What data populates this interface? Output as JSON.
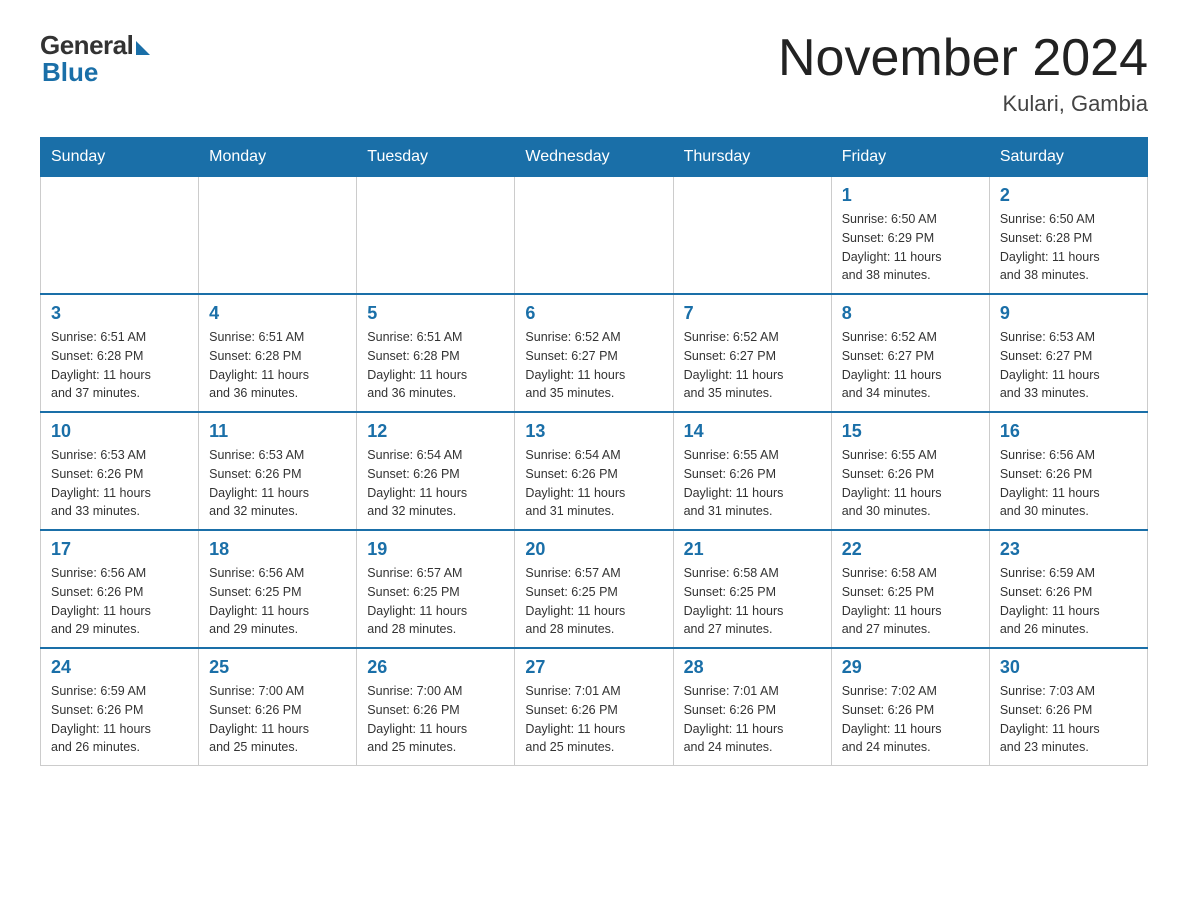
{
  "logo": {
    "general": "General",
    "blue": "Blue"
  },
  "title": "November 2024",
  "subtitle": "Kulari, Gambia",
  "days_of_week": [
    "Sunday",
    "Monday",
    "Tuesday",
    "Wednesday",
    "Thursday",
    "Friday",
    "Saturday"
  ],
  "weeks": [
    [
      {
        "day": "",
        "info": ""
      },
      {
        "day": "",
        "info": ""
      },
      {
        "day": "",
        "info": ""
      },
      {
        "day": "",
        "info": ""
      },
      {
        "day": "",
        "info": ""
      },
      {
        "day": "1",
        "info": "Sunrise: 6:50 AM\nSunset: 6:29 PM\nDaylight: 11 hours\nand 38 minutes."
      },
      {
        "day": "2",
        "info": "Sunrise: 6:50 AM\nSunset: 6:28 PM\nDaylight: 11 hours\nand 38 minutes."
      }
    ],
    [
      {
        "day": "3",
        "info": "Sunrise: 6:51 AM\nSunset: 6:28 PM\nDaylight: 11 hours\nand 37 minutes."
      },
      {
        "day": "4",
        "info": "Sunrise: 6:51 AM\nSunset: 6:28 PM\nDaylight: 11 hours\nand 36 minutes."
      },
      {
        "day": "5",
        "info": "Sunrise: 6:51 AM\nSunset: 6:28 PM\nDaylight: 11 hours\nand 36 minutes."
      },
      {
        "day": "6",
        "info": "Sunrise: 6:52 AM\nSunset: 6:27 PM\nDaylight: 11 hours\nand 35 minutes."
      },
      {
        "day": "7",
        "info": "Sunrise: 6:52 AM\nSunset: 6:27 PM\nDaylight: 11 hours\nand 35 minutes."
      },
      {
        "day": "8",
        "info": "Sunrise: 6:52 AM\nSunset: 6:27 PM\nDaylight: 11 hours\nand 34 minutes."
      },
      {
        "day": "9",
        "info": "Sunrise: 6:53 AM\nSunset: 6:27 PM\nDaylight: 11 hours\nand 33 minutes."
      }
    ],
    [
      {
        "day": "10",
        "info": "Sunrise: 6:53 AM\nSunset: 6:26 PM\nDaylight: 11 hours\nand 33 minutes."
      },
      {
        "day": "11",
        "info": "Sunrise: 6:53 AM\nSunset: 6:26 PM\nDaylight: 11 hours\nand 32 minutes."
      },
      {
        "day": "12",
        "info": "Sunrise: 6:54 AM\nSunset: 6:26 PM\nDaylight: 11 hours\nand 32 minutes."
      },
      {
        "day": "13",
        "info": "Sunrise: 6:54 AM\nSunset: 6:26 PM\nDaylight: 11 hours\nand 31 minutes."
      },
      {
        "day": "14",
        "info": "Sunrise: 6:55 AM\nSunset: 6:26 PM\nDaylight: 11 hours\nand 31 minutes."
      },
      {
        "day": "15",
        "info": "Sunrise: 6:55 AM\nSunset: 6:26 PM\nDaylight: 11 hours\nand 30 minutes."
      },
      {
        "day": "16",
        "info": "Sunrise: 6:56 AM\nSunset: 6:26 PM\nDaylight: 11 hours\nand 30 minutes."
      }
    ],
    [
      {
        "day": "17",
        "info": "Sunrise: 6:56 AM\nSunset: 6:26 PM\nDaylight: 11 hours\nand 29 minutes."
      },
      {
        "day": "18",
        "info": "Sunrise: 6:56 AM\nSunset: 6:25 PM\nDaylight: 11 hours\nand 29 minutes."
      },
      {
        "day": "19",
        "info": "Sunrise: 6:57 AM\nSunset: 6:25 PM\nDaylight: 11 hours\nand 28 minutes."
      },
      {
        "day": "20",
        "info": "Sunrise: 6:57 AM\nSunset: 6:25 PM\nDaylight: 11 hours\nand 28 minutes."
      },
      {
        "day": "21",
        "info": "Sunrise: 6:58 AM\nSunset: 6:25 PM\nDaylight: 11 hours\nand 27 minutes."
      },
      {
        "day": "22",
        "info": "Sunrise: 6:58 AM\nSunset: 6:25 PM\nDaylight: 11 hours\nand 27 minutes."
      },
      {
        "day": "23",
        "info": "Sunrise: 6:59 AM\nSunset: 6:26 PM\nDaylight: 11 hours\nand 26 minutes."
      }
    ],
    [
      {
        "day": "24",
        "info": "Sunrise: 6:59 AM\nSunset: 6:26 PM\nDaylight: 11 hours\nand 26 minutes."
      },
      {
        "day": "25",
        "info": "Sunrise: 7:00 AM\nSunset: 6:26 PM\nDaylight: 11 hours\nand 25 minutes."
      },
      {
        "day": "26",
        "info": "Sunrise: 7:00 AM\nSunset: 6:26 PM\nDaylight: 11 hours\nand 25 minutes."
      },
      {
        "day": "27",
        "info": "Sunrise: 7:01 AM\nSunset: 6:26 PM\nDaylight: 11 hours\nand 25 minutes."
      },
      {
        "day": "28",
        "info": "Sunrise: 7:01 AM\nSunset: 6:26 PM\nDaylight: 11 hours\nand 24 minutes."
      },
      {
        "day": "29",
        "info": "Sunrise: 7:02 AM\nSunset: 6:26 PM\nDaylight: 11 hours\nand 24 minutes."
      },
      {
        "day": "30",
        "info": "Sunrise: 7:03 AM\nSunset: 6:26 PM\nDaylight: 11 hours\nand 23 minutes."
      }
    ]
  ]
}
